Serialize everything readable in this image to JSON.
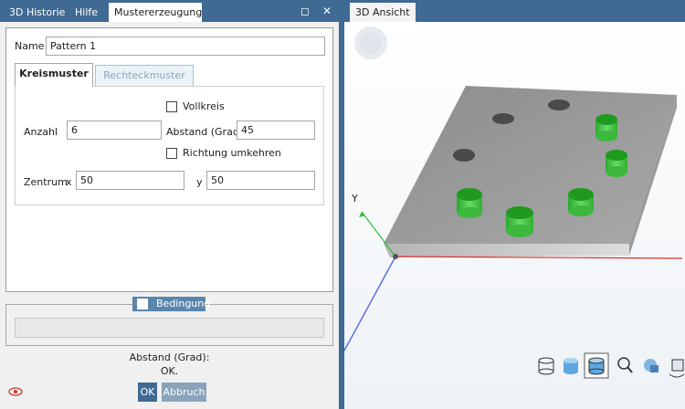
{
  "left_tabs": [
    {
      "label": "3D Historie",
      "active": false
    },
    {
      "label": "Hilfe",
      "active": false
    },
    {
      "label": "Mustererzeugung",
      "active": true
    }
  ],
  "window_buttons": {
    "restore": "◻",
    "close": "✕"
  },
  "form": {
    "name_label": "Name",
    "name_value": "Pattern 1",
    "tabs": {
      "circle": "Kreismuster",
      "rect": "Rechteckmuster"
    },
    "vollkreis_label": "Vollkreis",
    "anzahl_label": "Anzahl",
    "anzahl_value": "6",
    "abstand_label": "Abstand (Grad)",
    "abstand_value": "45",
    "richtung_label": "Richtung umkehren",
    "zentrum_label": "Zentrum",
    "x_label": "x",
    "x_value": "50",
    "y_label": "y",
    "y_value": "50"
  },
  "bedingung": {
    "label": "Bedingung",
    "value": ""
  },
  "status": {
    "line1": "Abstand (Grad):",
    "line2": "OK."
  },
  "buttons": {
    "ok": "OK",
    "cancel": "Abbruch"
  },
  "right_tab": "3D Ansicht",
  "viewport": {
    "axis_y_label": "Y"
  },
  "colors": {
    "accent": "#3e6a93",
    "pin_green": "#2db82d",
    "axis_x": "#e03030",
    "axis_y": "#30c030",
    "axis_z": "#6070e0"
  }
}
